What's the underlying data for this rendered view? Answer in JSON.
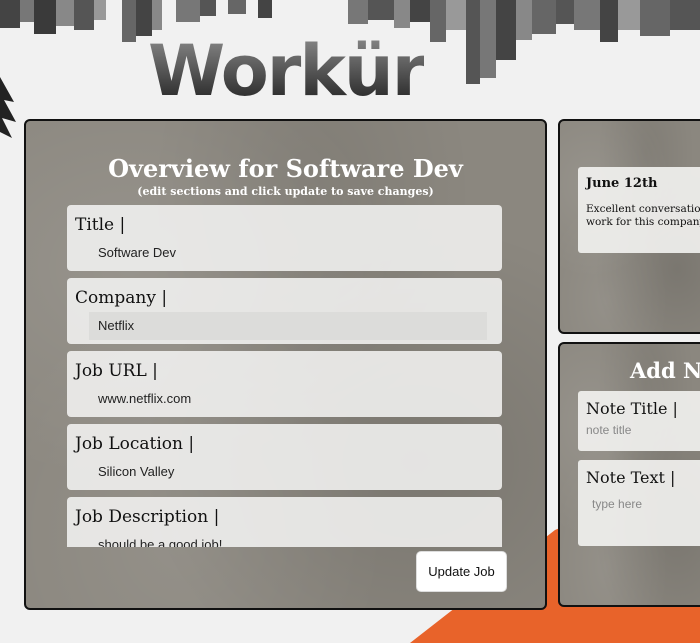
{
  "app": {
    "logo": "Workür"
  },
  "overview": {
    "title": "Overview for Software Dev",
    "subtitle": "(edit sections and click update to save changes)",
    "fields": [
      {
        "label": "Title |",
        "value": "Software Dev"
      },
      {
        "label": "Company |",
        "value": "Netflix"
      },
      {
        "label": "Job URL |",
        "value": "www.netflix.com"
      },
      {
        "label": "Job Location |",
        "value": "Silicon Valley"
      },
      {
        "label": "Job Description |",
        "value": "should be a good job!"
      }
    ],
    "update_label": "Update Job"
  },
  "notes": {
    "items": [
      {
        "date": "June 12th",
        "text_line1": "Excellent conversation",
        "text_line2": "work for this company."
      }
    ]
  },
  "add_note": {
    "title": "Add No",
    "note_title_label": "Note Title |",
    "note_title_placeholder": "note title",
    "note_text_label": "Note Text |",
    "note_text_placeholder": "type here"
  },
  "colors": {
    "accent": "#e8632a",
    "panel": "#8b877f",
    "field_bg": "#f3f3f1"
  }
}
